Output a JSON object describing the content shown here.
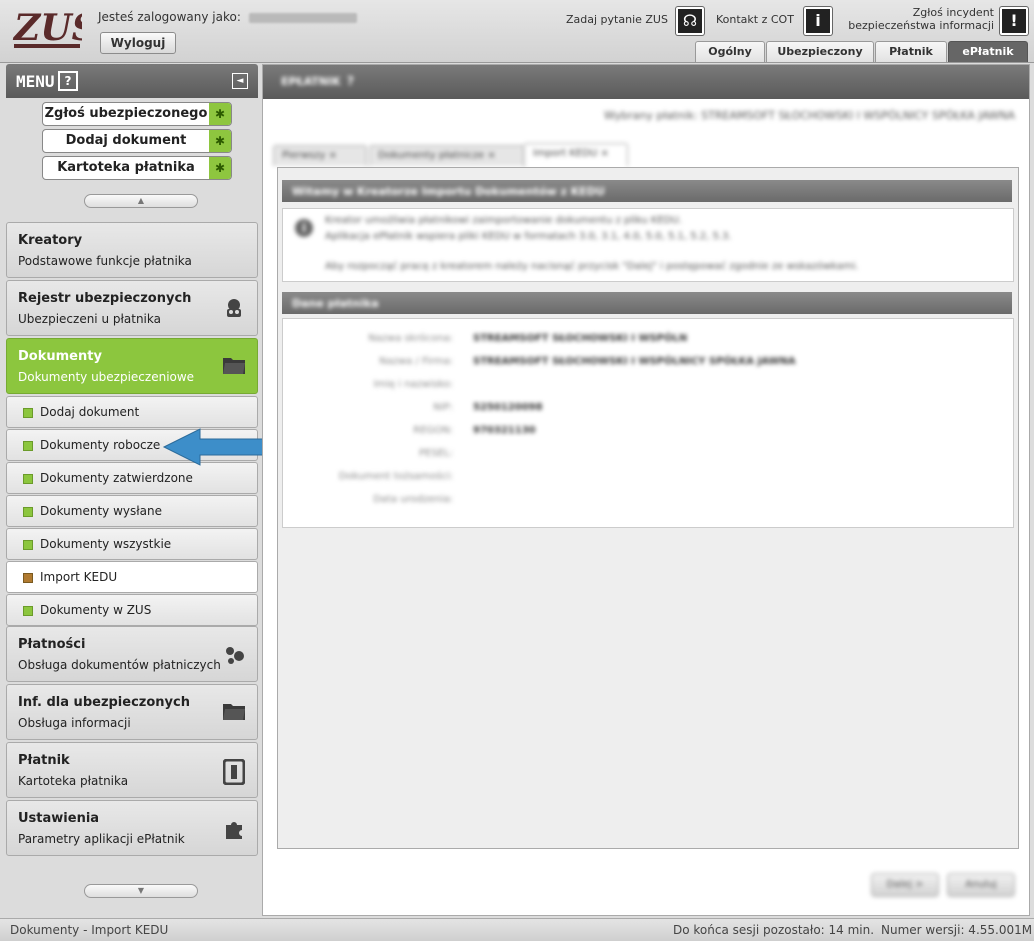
{
  "header": {
    "logo": "ZUS",
    "login_label": "Jesteś zalogowany jako:",
    "logout_label": "Wyloguj",
    "ask_label": "Zadaj pytanie ZUS",
    "contact_label": "Kontakt z COT",
    "incident_line1": "Zgłoś incydent",
    "incident_line2": "bezpieczeństwa informacji",
    "tabs": [
      {
        "label": "Ogólny"
      },
      {
        "label": "Ubezpieczony"
      },
      {
        "label": "Płatnik"
      },
      {
        "label": "ePłatnik"
      }
    ],
    "active_tab_color": "#666666"
  },
  "sidebar": {
    "title": "MENU",
    "help": "?",
    "collapse": "◄",
    "quick": [
      {
        "label": "Zgłoś ubezpieczonego"
      },
      {
        "label": "Dodaj dokument"
      },
      {
        "label": "Kartoteka płatnika"
      }
    ],
    "up_arrow": "▲",
    "down_arrow": "▼",
    "sections_top": [
      {
        "title": "Kreatory",
        "subtitle": "Podstawowe funkcje płatnika",
        "icon": ""
      },
      {
        "title": "Rejestr ubezpieczonych",
        "subtitle": "Ubezpieczeni u płatnika",
        "icon": "people-icon"
      },
      {
        "title": "Dokumenty",
        "subtitle": "Dokumenty ubezpieczeniowe",
        "icon": "folder-icon"
      }
    ],
    "sub_items": [
      {
        "label": "Dodaj dokument"
      },
      {
        "label": "Dokumenty robocze"
      },
      {
        "label": "Dokumenty zatwierdzone"
      },
      {
        "label": "Dokumenty wysłane"
      },
      {
        "label": "Dokumenty wszystkie"
      },
      {
        "label": "Import KEDU"
      },
      {
        "label": "Dokumenty w ZUS"
      }
    ],
    "selected_sub": "Import KEDU",
    "sections_bottom": [
      {
        "title": "Płatności",
        "subtitle": "Obsługa dokumentów płatniczych",
        "icon": "coins-icon"
      },
      {
        "title": "Inf. dla ubezpieczonych",
        "subtitle": "Obsługa informacji",
        "icon": "folder-icon"
      },
      {
        "title": "Płatnik",
        "subtitle": "Kartoteka płatnika",
        "icon": "card-icon"
      },
      {
        "title": "Ustawienia",
        "subtitle": "Parametry aplikacji ePłatnik",
        "icon": "puzzle-icon"
      }
    ],
    "accent_color": "#8cc63e"
  },
  "main": {
    "head_title": "EPŁATNIK",
    "head_help": "?",
    "crumb": "Wybrany płatnik: STREAMSOFT SŁOCHOWSKI I WSPÓLNICY SPÓŁKA JAWNA",
    "page_tabs": [
      {
        "label": "Pierwszy ×"
      },
      {
        "label": "Dokumenty płatnicze ×"
      },
      {
        "label": "Import KEDU ×"
      }
    ],
    "wizard_title": "Witamy w Kreatorze Importu Dokumentów z KEDU",
    "info_line1": "Kreator umożliwia płatnikowi zaimportowanie dokumentu z pliku KEDU.",
    "info_line2": "Aplikacja ePłatnik wspiera pliki KEDU w formatach 3.0, 3.1, 4.0, 5.0, 5.1, 5.2, 5.3.",
    "info_line3": "Aby rozpocząć pracę z kreatorem należy nacisnąć przycisk \"Dalej\" i postępować zgodnie ze wskazówkami.",
    "data_title": "Dane płatnika",
    "rows": [
      {
        "label": "Nazwa skrócona:",
        "value": "STREAMSOFT SŁOCHOWSKI I WSPÓLN"
      },
      {
        "label": "Nazwa / Firma:",
        "value": "STREAMSOFT SŁOCHOWSKI I WSPÓLNICY SPÓŁKA JAWNA"
      },
      {
        "label": "Imię i nazwisko:",
        "value": ""
      },
      {
        "label": "NIP:",
        "value": "5250120098"
      },
      {
        "label": "REGON:",
        "value": "970321130"
      },
      {
        "label": "PESEL:",
        "value": ""
      },
      {
        "label": "Dokument tożsamości:",
        "value": ""
      },
      {
        "label": "Data urodzenia:",
        "value": ""
      }
    ],
    "btn_next": "Dalej >",
    "btn_cancel": "Anuluj"
  },
  "status": {
    "left": "Dokumenty - Import KEDU",
    "session": "Do końca sesji pozostało: 14 min.",
    "version": "Numer wersji: 4.55.001M"
  }
}
